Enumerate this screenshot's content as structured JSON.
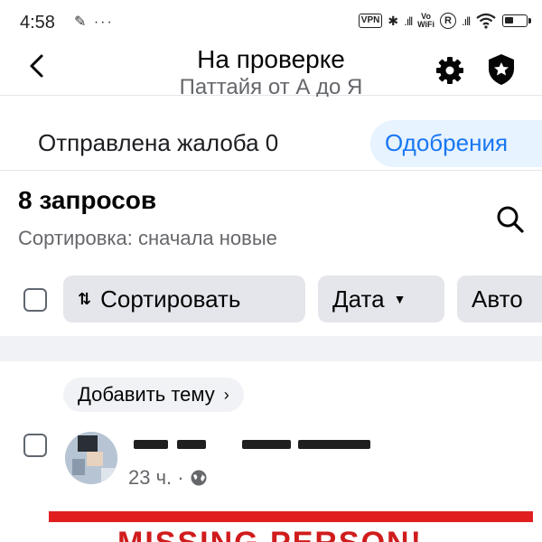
{
  "status_bar": {
    "time": "4:58",
    "left_icons": "✎ ···",
    "vpn": "VPN",
    "bluetooth": "✱",
    "signal": ".ıll",
    "volte_top": "Vo",
    "volte_bottom": "WiFi",
    "r_badge": "R",
    "signal2": ".ıll"
  },
  "header": {
    "title": "На проверке",
    "subtitle": "Паттайя от А до Я"
  },
  "tabs": {
    "complaint": "Отправлена жалоба 0",
    "approvals": "Одобрения"
  },
  "requests": {
    "count": "8 запросов",
    "sort_info": "Сортировка: сначала новые"
  },
  "filters": {
    "sort_label": "Сортировать",
    "sort_glyph": "⇅",
    "date_label": "Дата",
    "author_label": "Авто"
  },
  "post": {
    "add_topic": "Добавить тему",
    "add_topic_chevron": "›",
    "time": "23 ч. ·",
    "headline": "MISSING PERSON!"
  },
  "colors": {
    "accent": "#1877f2",
    "tab_bg": "#e7f3ff",
    "chip_bg": "#e4e6eb",
    "banner_red": "#e02020"
  }
}
